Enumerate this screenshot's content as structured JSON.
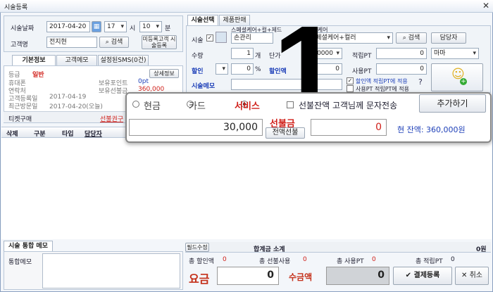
{
  "window": {
    "title": "시술등록"
  },
  "left": {
    "date_label": "시술날짜",
    "date_value": "2017-04-20",
    "hour": "17",
    "hour_unit": "시",
    "minute": "10",
    "minute_unit": "분",
    "customer_label": "고객명",
    "customer_value": "전지현",
    "search_btn": "검색",
    "unregistered_btn": "미등록고객 시술등록",
    "tabs": [
      "기본정보",
      "고객메모",
      "설정된SMS(0건)"
    ],
    "grade_label": "등급",
    "grade_value": "일반",
    "detail_btn": "상세정보",
    "holiday_label": "휴대폰",
    "points_label": "보유포인트",
    "points_value": "0pt",
    "contact_label": "연락처",
    "prepaid_label": "보유선불금",
    "prepaid_value": "360,000",
    "first_visit_label": "고객등록일",
    "first_visit_value": "2017-04-19",
    "last_visit_label": "최근방문일",
    "last_visit_value": "2017-04-20(오늘)",
    "ticket_label": "티켓구매",
    "ticket_value": "선불권구",
    "grid_cols": [
      "삭제",
      "구분",
      "타입",
      "담당자"
    ]
  },
  "right": {
    "tabs": [
      "시술선택",
      "제품판매"
    ],
    "sub_tab_a": "스페셜케어+컬+제드",
    "sub_tab_b": "기본케어",
    "service_label": "시술",
    "service_value": "손관리",
    "service2_value": "스페셜케어+컬러",
    "search_btn": "검색",
    "staff_btn": "담당자",
    "qty_label": "수량",
    "qty_value": "1",
    "qty_unit": "개",
    "price_label": "단가",
    "price_value": "30000",
    "earn_pt_label": "적립PT",
    "earn_pt_value": "0",
    "staff_value": "마마",
    "discount_label": "할인",
    "discount_value": "0",
    "discount_unit": "%",
    "discount_amt_label": "할인액",
    "discount_amt_value": "0",
    "use_pt_label": "사용PT",
    "use_pt_value": "0",
    "memo_label": "시술메모",
    "opt1": "할인액 적립PT에 적용",
    "opt2": "사용PT 적립PT에 적용"
  },
  "popup": {
    "pay_methods": [
      "현금",
      "카드",
      "서비스"
    ],
    "prepaid_checkbox": "선불잔액 고객님께 문자전송",
    "add_btn": "추가하기",
    "amount": "30,000",
    "prepaid_title": "선불금",
    "prepaid_sub": "전액선불",
    "prepaid_amount": "0",
    "balance_text": "현 잔액: 360,000원"
  },
  "overlay_number": "1",
  "bottom": {
    "memo_tab": "시술 통합 메모",
    "memo_label": "통합메모",
    "edit_btn": "필드수정",
    "total_label": "합계금 소계",
    "total_value": "0원",
    "disc_total_label": "총 할인액",
    "disc_total_value": "0",
    "prepaid_use_label": "총 선불사용",
    "prepaid_use_value": "0",
    "pt_use_label": "총 사용PT",
    "pt_use_value": "0",
    "pt_earn_label": "총 적립PT",
    "pt_earn_value": "0",
    "fee_label": "요금",
    "fee_value": "0",
    "receive_label": "수금액",
    "receive_value": "0",
    "pay_btn": "결제등록",
    "cancel_btn": "취소"
  },
  "colors": {
    "accent_red": "#d0201a",
    "accent_blue": "#1d3fb8",
    "panel": "#f0f4f8"
  }
}
